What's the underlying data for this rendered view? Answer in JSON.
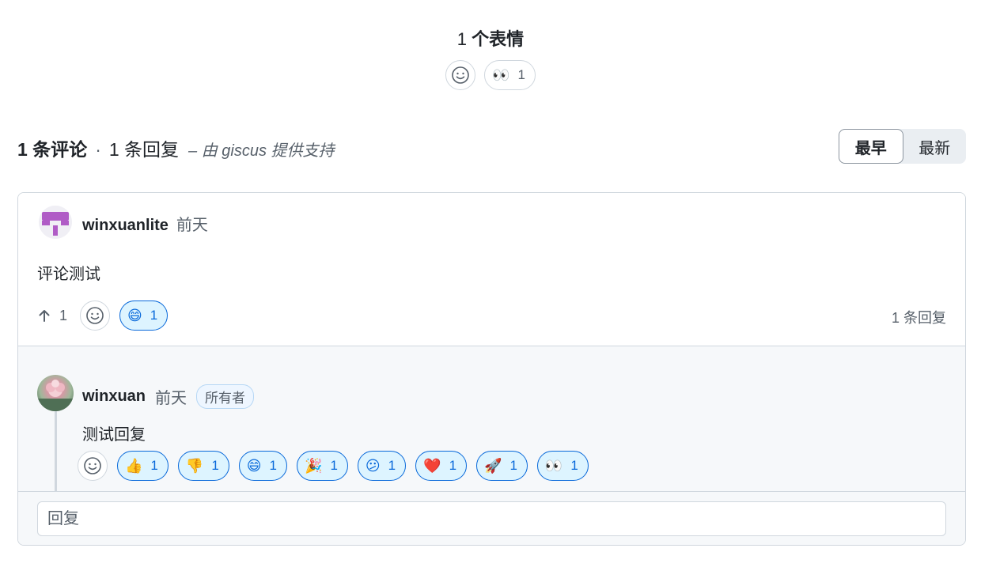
{
  "reactions_header": {
    "count": "1",
    "label": "个表情"
  },
  "top_reactions": [
    {
      "icon": "eyes-emoji",
      "emoji": "👀",
      "count": "1"
    }
  ],
  "summary": {
    "comments": "1 条评论",
    "separator": "·",
    "replies": "1 条回复",
    "powered_by": "– 由 giscus 提供支持"
  },
  "sort": {
    "oldest": "最早",
    "newest": "最新",
    "selected": "oldest"
  },
  "comment": {
    "author": "winxuanlite",
    "time": "前天",
    "body": "评论测试",
    "upvotes": "1",
    "reactions": [
      {
        "icon": "grin-emoji",
        "emoji": "😄",
        "count": "1"
      }
    ],
    "reply_count": "1 条回复"
  },
  "reply": {
    "author": "winxuan",
    "time": "前天",
    "badge": "所有者",
    "body": "测试回复",
    "reactions": [
      {
        "icon": "thumbs-up-emoji",
        "emoji": "👍",
        "count": "1"
      },
      {
        "icon": "thumbs-down-emoji",
        "emoji": "👎",
        "count": "1"
      },
      {
        "icon": "grin-emoji",
        "emoji": "😄",
        "count": "1"
      },
      {
        "icon": "party-popper-emoji",
        "emoji": "🎉",
        "count": "1"
      },
      {
        "icon": "confused-emoji",
        "emoji": "😕",
        "count": "1"
      },
      {
        "icon": "heart-emoji",
        "emoji": "❤️",
        "count": "1"
      },
      {
        "icon": "rocket-emoji",
        "emoji": "🚀",
        "count": "1"
      },
      {
        "icon": "eyes-emoji",
        "emoji": "👀",
        "count": "1"
      }
    ]
  },
  "reply_input": {
    "placeholder": "回复"
  },
  "colors": {
    "accent": "#0969da",
    "accent_bg": "#ddf4ff",
    "border": "#d0d7de",
    "muted": "#57606a"
  }
}
